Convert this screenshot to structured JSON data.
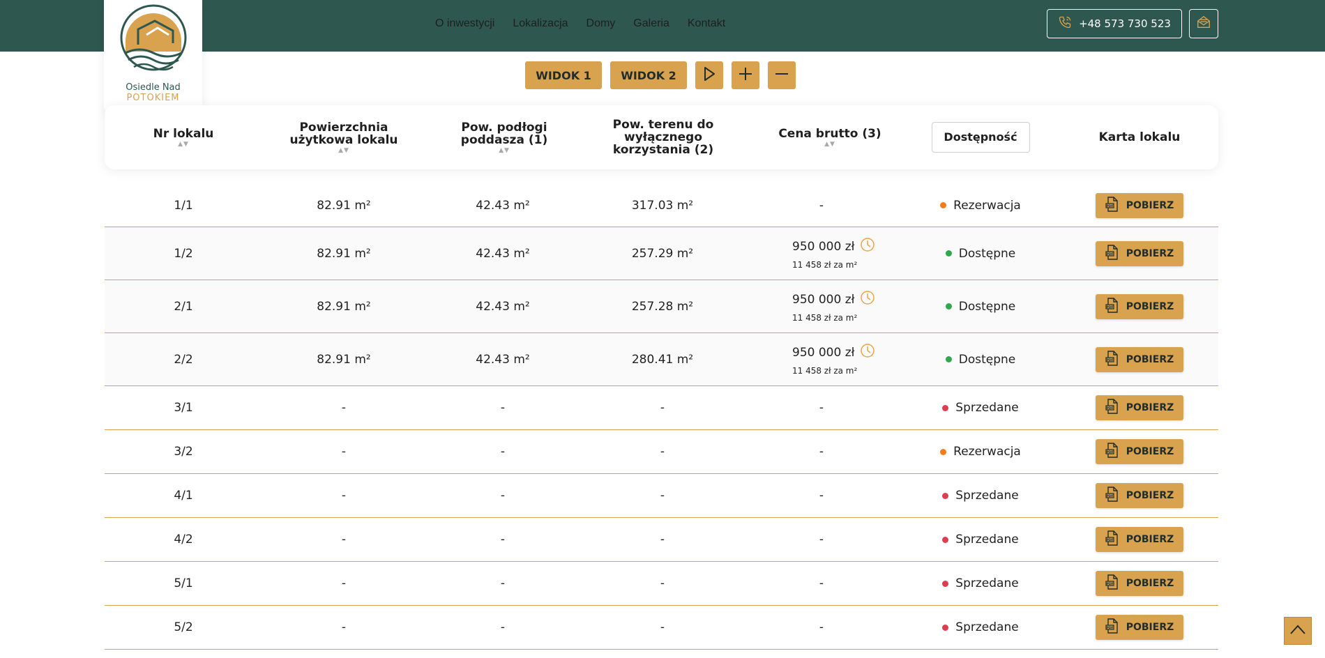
{
  "header": {
    "nav": [
      "O inwestycji",
      "Lokalizacja",
      "Domy",
      "Galeria",
      "Kontakt"
    ],
    "phone": "+48 573 730 523"
  },
  "logo": {
    "line1": "Osiedle Nad",
    "line2": "POTOKIEM"
  },
  "controls": {
    "view1": "WIDOK 1",
    "view2": "WIDOK 2"
  },
  "table": {
    "headers": {
      "nr": "Nr lokalu",
      "area": "Powierzchnia użytkowa lokalu",
      "attic": "Pow. podłogi poddasza (1)",
      "land": "Pow. terenu do wyłącznego korzystania (2)",
      "price": "Cena brutto (3)",
      "availability": "Dostępność",
      "card": "Karta lokalu"
    },
    "button_label": "POBIERZ",
    "status_colors": {
      "Rezerwacja": "#f07d1a",
      "Dostępne": "#2ea84a",
      "Sprzedane": "#e03c4f"
    },
    "rows": [
      {
        "nr": "1/1",
        "area": "82.91 m²",
        "attic": "42.43 m²",
        "land": "317.03 m²",
        "price": "-",
        "price_per_m2": "",
        "status": "Rezerwacja"
      },
      {
        "nr": "1/2",
        "area": "82.91 m²",
        "attic": "42.43 m²",
        "land": "257.29 m²",
        "price": "950 000 zł",
        "price_per_m2": "11 458 zł za m²",
        "status": "Dostępne"
      },
      {
        "nr": "2/1",
        "area": "82.91 m²",
        "attic": "42.43 m²",
        "land": "257.28 m²",
        "price": "950 000 zł",
        "price_per_m2": "11 458 zł za m²",
        "status": "Dostępne"
      },
      {
        "nr": "2/2",
        "area": "82.91 m²",
        "attic": "42.43 m²",
        "land": "280.41 m²",
        "price": "950 000 zł",
        "price_per_m2": "11 458 zł za m²",
        "status": "Dostępne"
      },
      {
        "nr": "3/1",
        "area": "-",
        "attic": "-",
        "land": "-",
        "price": "-",
        "price_per_m2": "",
        "status": "Sprzedane"
      },
      {
        "nr": "3/2",
        "area": "-",
        "attic": "-",
        "land": "-",
        "price": "-",
        "price_per_m2": "",
        "status": "Rezerwacja"
      },
      {
        "nr": "4/1",
        "area": "-",
        "attic": "-",
        "land": "-",
        "price": "-",
        "price_per_m2": "",
        "status": "Sprzedane"
      },
      {
        "nr": "4/2",
        "area": "-",
        "attic": "-",
        "land": "-",
        "price": "-",
        "price_per_m2": "",
        "status": "Sprzedane"
      },
      {
        "nr": "5/1",
        "area": "-",
        "attic": "-",
        "land": "-",
        "price": "-",
        "price_per_m2": "",
        "status": "Sprzedane"
      },
      {
        "nr": "5/2",
        "area": "-",
        "attic": "-",
        "land": "-",
        "price": "-",
        "price_per_m2": "",
        "status": "Sprzedane"
      }
    ]
  }
}
